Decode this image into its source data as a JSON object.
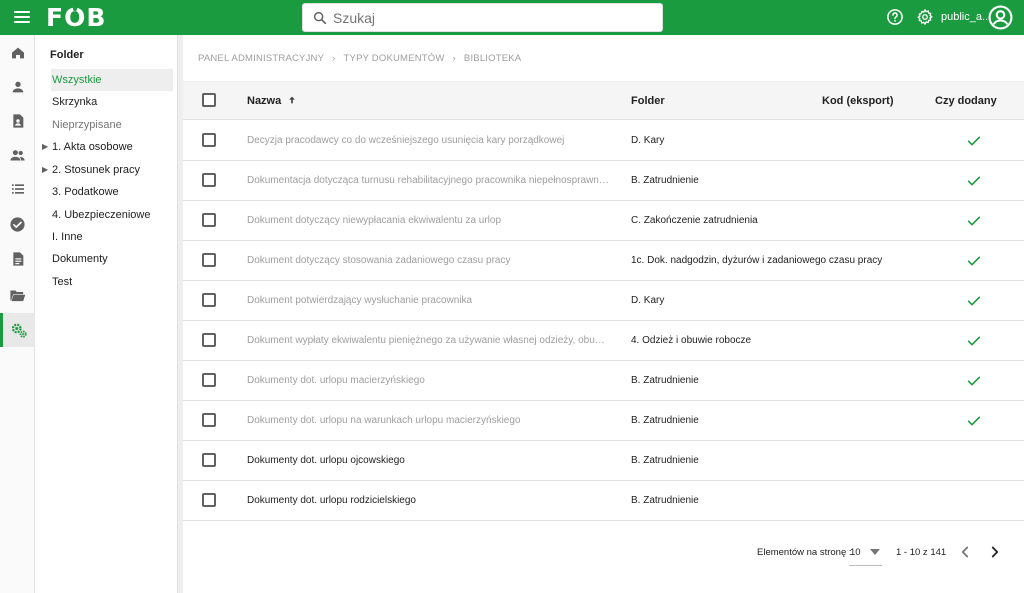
{
  "app": {
    "logo": "FOB",
    "username": "public_a...",
    "accent_color": "#1a9b3f"
  },
  "search": {
    "placeholder": "Szukaj"
  },
  "rail": {
    "icons": [
      "home-icon",
      "person-icon",
      "contact-document-icon",
      "people-icon",
      "list-icon",
      "check-circle-icon",
      "document-icon",
      "folder-open-icon",
      "settings-gears-icon"
    ],
    "active": "settings-gears-icon"
  },
  "sidebar": {
    "title": "Folder",
    "items": [
      {
        "label": "Wszystkie",
        "state": "active",
        "expandable": false
      },
      {
        "label": "Skrzynka",
        "state": "normal",
        "expandable": false
      },
      {
        "label": "Nieprzypisane",
        "state": "muted",
        "expandable": false
      },
      {
        "label": "1. Akta osobowe",
        "state": "normal",
        "expandable": true
      },
      {
        "label": "2. Stosunek pracy",
        "state": "normal",
        "expandable": true
      },
      {
        "label": "3. Podatkowe",
        "state": "normal",
        "expandable": false
      },
      {
        "label": "4. Ubezpieczeniowe",
        "state": "normal",
        "expandable": false
      },
      {
        "label": "I. Inne",
        "state": "normal",
        "expandable": false
      },
      {
        "label": "Dokumenty",
        "state": "normal",
        "expandable": false
      },
      {
        "label": "Test",
        "state": "normal",
        "expandable": false
      }
    ]
  },
  "breadcrumb": [
    "PANEL ADMINISTRACYJNY",
    "TYPY DOKUMENTÓW",
    "BIBLIOTEKA"
  ],
  "table": {
    "columns": {
      "name": "Nazwa",
      "folder": "Folder",
      "code": "Kod (eksport)",
      "added": "Czy dodany"
    },
    "sort": {
      "column": "name",
      "direction": "ascending"
    },
    "rows": [
      {
        "name": "Decyzja pracodawcy co do wcześniejszego usunięcia kary porządkowej",
        "folder": "D. Kary",
        "code": "",
        "added": true
      },
      {
        "name": "Dokumentacja dotycząca turnusu rehabilitacyjnego pracownika niepełnosprawnego",
        "folder": "B. Zatrudnienie",
        "code": "",
        "added": true
      },
      {
        "name": "Dokument dotyczący niewypłacania ekwiwalentu za urlop",
        "folder": "C. Zakończenie zatrudnienia",
        "code": "",
        "added": true
      },
      {
        "name": "Dokument dotyczący stosowania zadaniowego czasu pracy",
        "folder": "1c. Dok. nadgodzin, dyżurów i zadaniowego czasu pracy",
        "code": "",
        "added": true
      },
      {
        "name": "Dokument potwierdzający wysłuchanie pracownika",
        "folder": "D. Kary",
        "code": "",
        "added": true
      },
      {
        "name": "Dokument wypłaty ekwiwalentu pieniężnego za używanie własnej odzieży, obuwia i ic...",
        "folder": "4. Odzież i obuwie robocze",
        "code": "",
        "added": true
      },
      {
        "name": "Dokumenty dot. urlopu macierzyńskiego",
        "folder": "B. Zatrudnienie",
        "code": "",
        "added": true
      },
      {
        "name": "Dokumenty dot. urlopu na warunkach urlopu macierzyńskiego",
        "folder": "B. Zatrudnienie",
        "code": "",
        "added": true
      },
      {
        "name": "Dokumenty dot. urlopu ojcowskiego",
        "folder": "B. Zatrudnienie",
        "code": "",
        "added": false
      },
      {
        "name": "Dokumenty dot. urlopu rodzicielskiego",
        "folder": "B. Zatrudnienie",
        "code": "",
        "added": false
      }
    ]
  },
  "pagination": {
    "per_page_label": "Elementów na stronę :",
    "per_page_value": "10",
    "range": "1 - 10 z 141"
  }
}
